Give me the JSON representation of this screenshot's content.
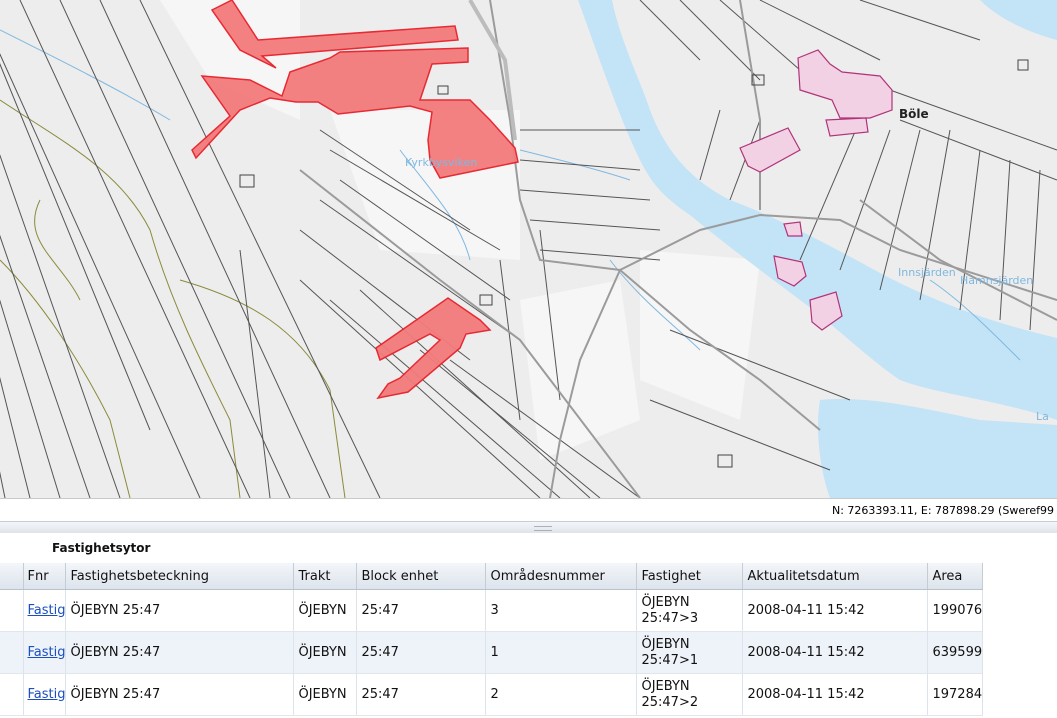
{
  "map": {
    "labels": {
      "bole": "Böle",
      "bay": "Kyrkbysviken",
      "lake1": "Innsjärden",
      "lake2": "Hamnsjärden",
      "edge": "La"
    },
    "colors": {
      "land": "#ededed",
      "water": "#c3e3f7",
      "water_text": "#7fb8e0",
      "selected_fill": "#f47b7b",
      "selected_stroke": "#e6202a",
      "building": "#b0337a",
      "parcel_line": "#444444",
      "road": "#999999",
      "contour": "#8c8a3c"
    }
  },
  "status_bar": {
    "coordinates": "N: 7263393.11, E: 787898.29 (Sweref99"
  },
  "results": {
    "title": "Fastighetsytor",
    "columns": [
      "Fnr",
      "Fastighetsbeteckning",
      "Trakt",
      "Block enhet",
      "Områdesnummer",
      "Fastighet",
      "Aktualitetsdatum",
      "Area"
    ],
    "rows": [
      {
        "fnr": "Fastig",
        "beteckning": "ÖJEBYN 25:47",
        "trakt": "ÖJEBYN",
        "block": "25:47",
        "omrade": "3",
        "fastighet": "ÖJEBYN 25:47>3",
        "datum": "2008-04-11 15:42",
        "area": "199076"
      },
      {
        "fnr": "Fastig",
        "beteckning": "ÖJEBYN 25:47",
        "trakt": "ÖJEBYN",
        "block": "25:47",
        "omrade": "1",
        "fastighet": "ÖJEBYN 25:47>1",
        "datum": "2008-04-11 15:42",
        "area": "639599"
      },
      {
        "fnr": "Fastig",
        "beteckning": "ÖJEBYN 25:47",
        "trakt": "ÖJEBYN",
        "block": "25:47",
        "omrade": "2",
        "fastighet": "ÖJEBYN 25:47>2",
        "datum": "2008-04-11 15:42",
        "area": "197284"
      }
    ]
  }
}
